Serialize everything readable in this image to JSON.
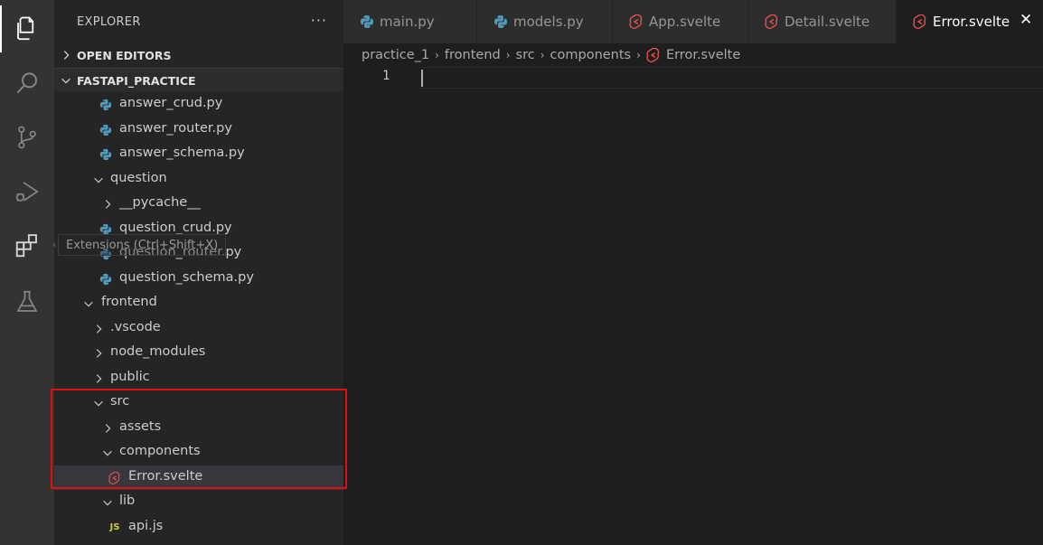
{
  "explorer": {
    "title": "EXPLORER",
    "more_label": "···",
    "sections": {
      "open_editors": "OPEN EDITORS",
      "project": "FASTAPI_PRACTICE"
    },
    "tree": [
      {
        "label": "answer_crud.py",
        "kind": "python"
      },
      {
        "label": "answer_router.py",
        "kind": "python"
      },
      {
        "label": "answer_schema.py",
        "kind": "python"
      },
      {
        "label": "question",
        "kind": "folder-open"
      },
      {
        "label": "__pycache__",
        "kind": "folder-closed"
      },
      {
        "label": "question_crud.py",
        "kind": "python"
      },
      {
        "label": "question_router.py",
        "kind": "python"
      },
      {
        "label": "question_schema.py",
        "kind": "python"
      },
      {
        "label": "frontend",
        "kind": "folder-open"
      },
      {
        "label": ".vscode",
        "kind": "folder-closed"
      },
      {
        "label": "node_modules",
        "kind": "folder-closed"
      },
      {
        "label": "public",
        "kind": "folder-closed"
      },
      {
        "label": "src",
        "kind": "folder-open"
      },
      {
        "label": "assets",
        "kind": "folder-closed"
      },
      {
        "label": "components",
        "kind": "folder-open"
      },
      {
        "label": "Error.svelte",
        "kind": "svelte",
        "selected": true
      },
      {
        "label": "lib",
        "kind": "folder-open"
      },
      {
        "label": "api.js",
        "kind": "javascript",
        "icon_text": "JS"
      }
    ]
  },
  "tooltip": {
    "text": "Extensions (Ctrl+Shift+X)"
  },
  "tabs": [
    {
      "label": "main.py",
      "kind": "python"
    },
    {
      "label": "models.py",
      "kind": "python"
    },
    {
      "label": "App.svelte",
      "kind": "svelte"
    },
    {
      "label": "Detail.svelte",
      "kind": "svelte"
    },
    {
      "label": "Error.svelte",
      "kind": "svelte",
      "active": true,
      "close": "✕"
    }
  ],
  "breadcrumb": {
    "items": [
      "practice_1",
      "frontend",
      "src",
      "components",
      "Error.svelte"
    ],
    "separator": "›"
  },
  "editor": {
    "line_number": "1"
  },
  "colors": {
    "python_icon": "#519aba",
    "svelte_icon": "#e44d4d",
    "js_icon": "#cbcb41",
    "highlight_box": "#e01010"
  }
}
